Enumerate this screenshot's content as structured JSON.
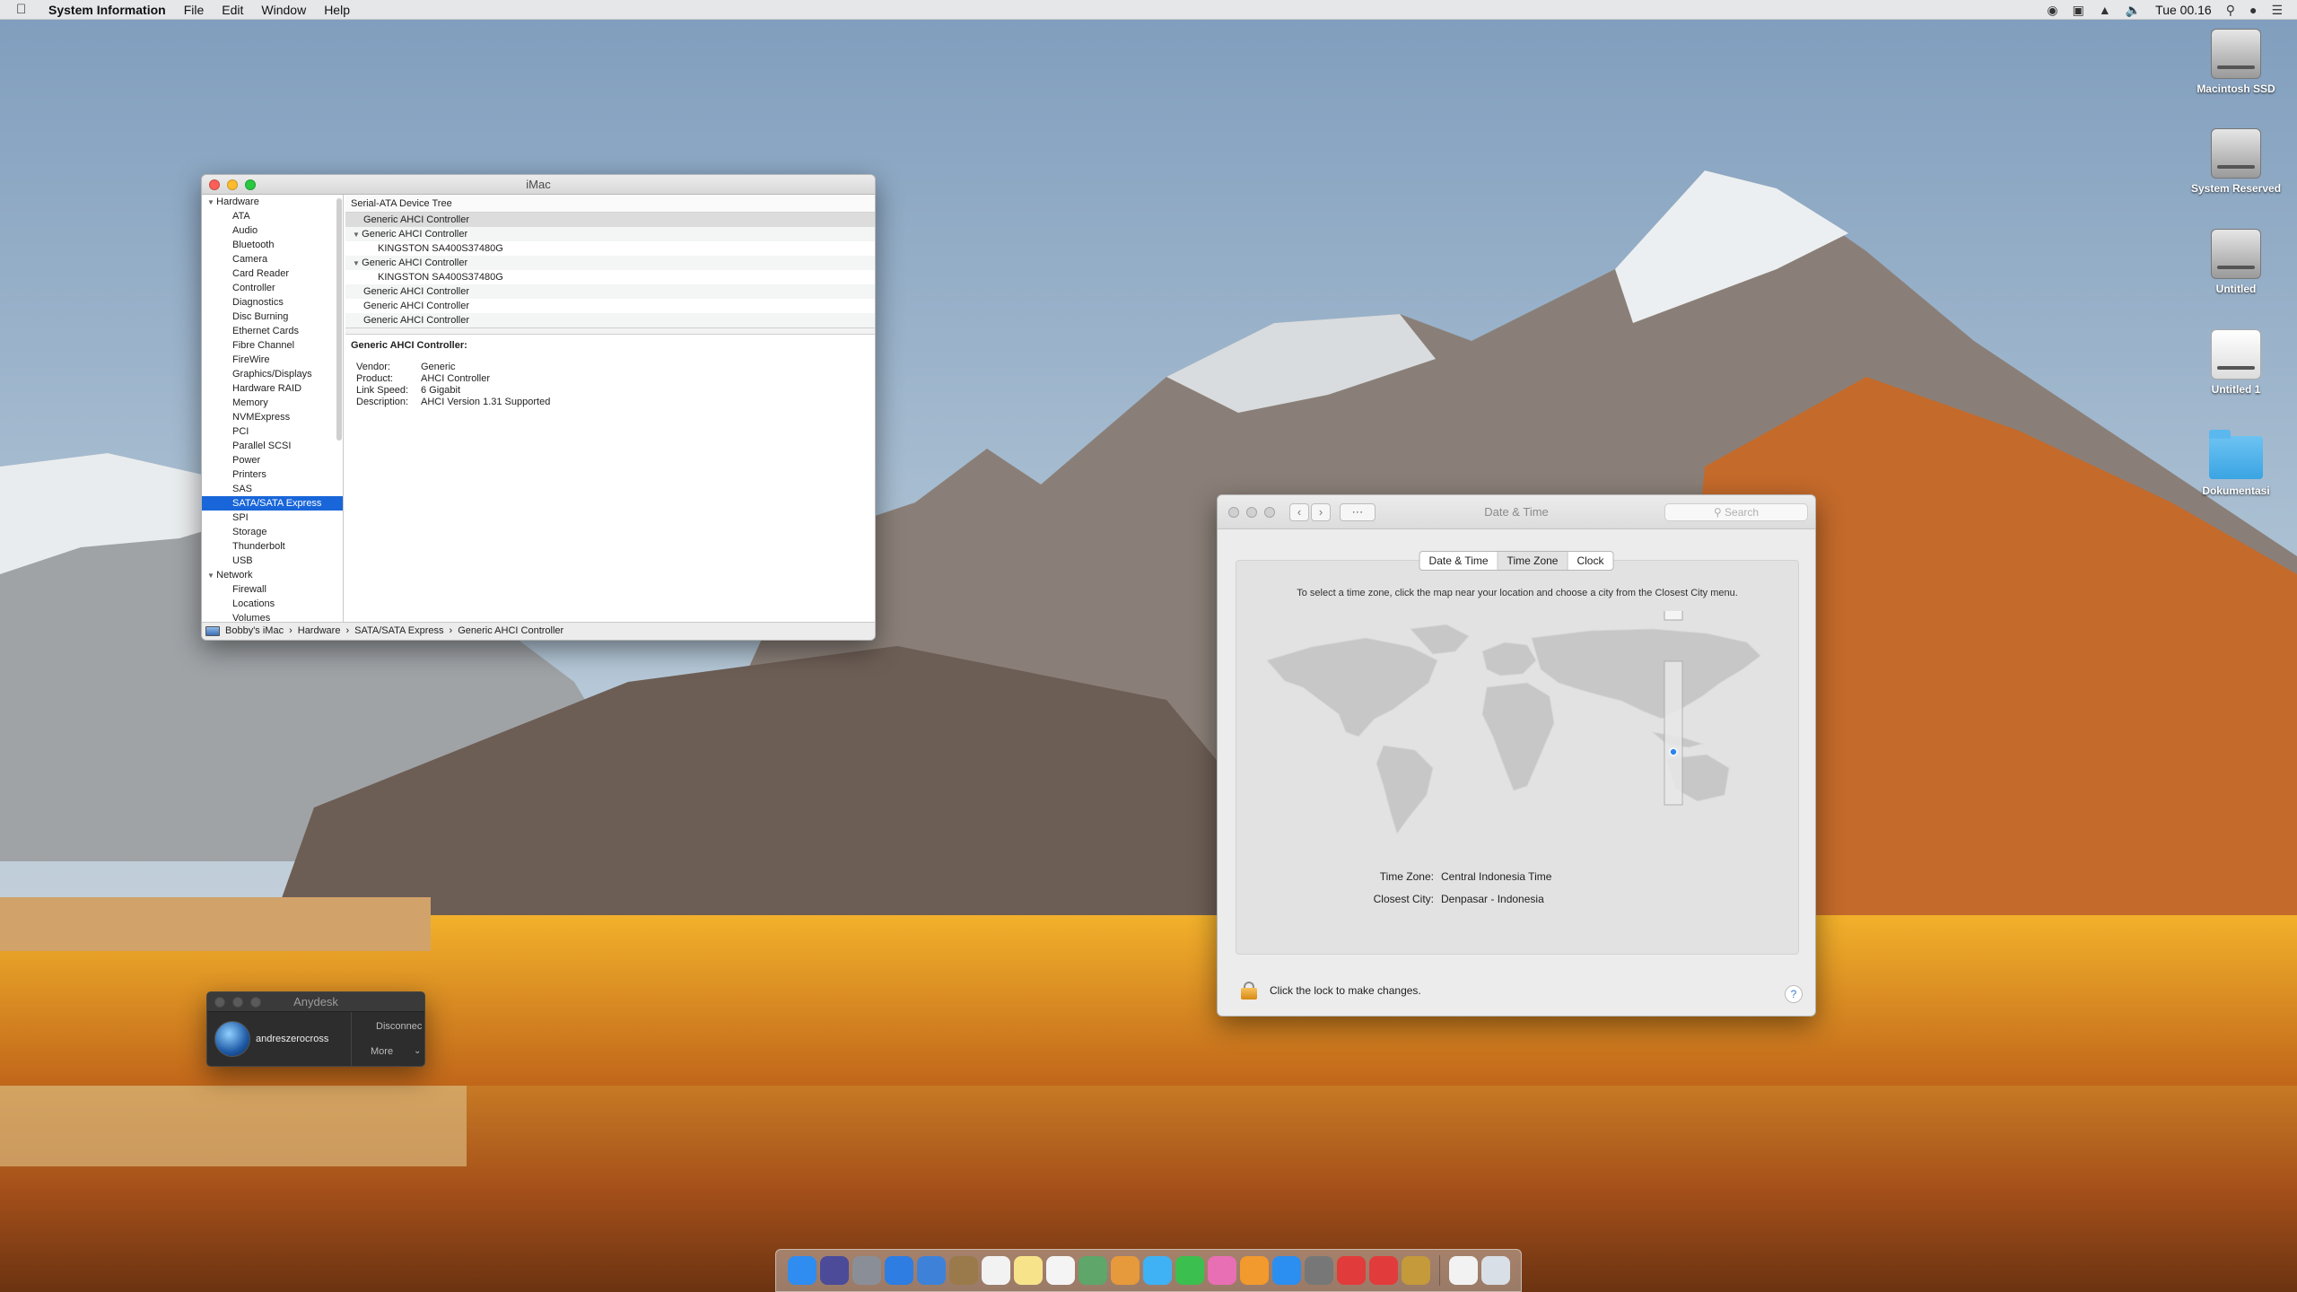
{
  "menubar": {
    "app_name": "System Information",
    "menus": [
      "File",
      "Edit",
      "Window",
      "Help"
    ],
    "clock": "Tue 00.16"
  },
  "desktop_icons": [
    {
      "label": "Macintosh SSD",
      "kind": "disk"
    },
    {
      "label": "System Reserved",
      "kind": "disk"
    },
    {
      "label": "Untitled",
      "kind": "disk"
    },
    {
      "label": "Untitled 1",
      "kind": "white-disk"
    },
    {
      "label": "Dokumentasi",
      "kind": "folder"
    }
  ],
  "sysinfo": {
    "title": "iMac",
    "sidebar": [
      {
        "label": "Hardware",
        "type": "group"
      },
      {
        "label": "ATA",
        "type": "leaf"
      },
      {
        "label": "Audio",
        "type": "leaf"
      },
      {
        "label": "Bluetooth",
        "type": "leaf"
      },
      {
        "label": "Camera",
        "type": "leaf"
      },
      {
        "label": "Card Reader",
        "type": "leaf"
      },
      {
        "label": "Controller",
        "type": "leaf"
      },
      {
        "label": "Diagnostics",
        "type": "leaf"
      },
      {
        "label": "Disc Burning",
        "type": "leaf"
      },
      {
        "label": "Ethernet Cards",
        "type": "leaf"
      },
      {
        "label": "Fibre Channel",
        "type": "leaf"
      },
      {
        "label": "FireWire",
        "type": "leaf"
      },
      {
        "label": "Graphics/Displays",
        "type": "leaf"
      },
      {
        "label": "Hardware RAID",
        "type": "leaf"
      },
      {
        "label": "Memory",
        "type": "leaf"
      },
      {
        "label": "NVMExpress",
        "type": "leaf"
      },
      {
        "label": "PCI",
        "type": "leaf"
      },
      {
        "label": "Parallel SCSI",
        "type": "leaf"
      },
      {
        "label": "Power",
        "type": "leaf"
      },
      {
        "label": "Printers",
        "type": "leaf"
      },
      {
        "label": "SAS",
        "type": "leaf"
      },
      {
        "label": "SATA/SATA Express",
        "type": "leaf",
        "selected": true
      },
      {
        "label": "SPI",
        "type": "leaf"
      },
      {
        "label": "Storage",
        "type": "leaf"
      },
      {
        "label": "Thunderbolt",
        "type": "leaf"
      },
      {
        "label": "USB",
        "type": "leaf"
      },
      {
        "label": "Network",
        "type": "group"
      },
      {
        "label": "Firewall",
        "type": "leaf"
      },
      {
        "label": "Locations",
        "type": "leaf"
      },
      {
        "label": "Volumes",
        "type": "leaf"
      }
    ],
    "tree_header": "Serial-ATA Device Tree",
    "tree_rows": [
      {
        "label": "Generic AHCI Controller",
        "level": 1,
        "selected": true
      },
      {
        "label": "Generic AHCI Controller",
        "level": 1,
        "expanded": true
      },
      {
        "label": "KINGSTON SA400S37480G",
        "level": 2
      },
      {
        "label": "Generic AHCI Controller",
        "level": 1,
        "expanded": true
      },
      {
        "label": "KINGSTON SA400S37480G",
        "level": 2
      },
      {
        "label": "Generic AHCI Controller",
        "level": 1
      },
      {
        "label": "Generic AHCI Controller",
        "level": 1
      },
      {
        "label": "Generic AHCI Controller",
        "level": 1
      }
    ],
    "detail": {
      "title": "Generic AHCI Controller:",
      "fields": [
        {
          "key": "Vendor:",
          "value": "Generic"
        },
        {
          "key": "Product:",
          "value": "AHCI Controller"
        },
        {
          "key": "Link Speed:",
          "value": "6 Gigabit"
        },
        {
          "key": "Description:",
          "value": "AHCI Version 1.31 Supported"
        }
      ]
    },
    "path": [
      "Bobby's iMac",
      "Hardware",
      "SATA/SATA Express",
      "Generic AHCI Controller"
    ]
  },
  "datetime": {
    "title": "Date & Time",
    "search_placeholder": "Search",
    "tabs": [
      {
        "label": "Date & Time",
        "active": false
      },
      {
        "label": "Time Zone",
        "active": true
      },
      {
        "label": "Clock",
        "active": false
      }
    ],
    "hint": "To select a time zone, click the map near your location and choose a city from the Closest City menu.",
    "time_zone_label": "Time Zone:",
    "time_zone_value": "Central Indonesia Time",
    "closest_city_label": "Closest City:",
    "closest_city_value": "Denpasar - Indonesia",
    "lock_text": "Click the lock to make changes.",
    "help": "?"
  },
  "anydesk": {
    "title": "Anydesk",
    "user": "andreszerocross",
    "disconnect": "Disconnec",
    "more": "More"
  },
  "dock": [
    {
      "name": "finder",
      "color": "#2f8cf0"
    },
    {
      "name": "siri",
      "color": "#4b4b9a"
    },
    {
      "name": "launchpad",
      "color": "#8a8f97"
    },
    {
      "name": "safari",
      "color": "#2d7de3"
    },
    {
      "name": "mail",
      "color": "#3d82d8"
    },
    {
      "name": "notes-book",
      "color": "#9a7a4b"
    },
    {
      "name": "calendar",
      "color": "#f2f2f2"
    },
    {
      "name": "notes",
      "color": "#f7e38a"
    },
    {
      "name": "reminders",
      "color": "#f4f4f4"
    },
    {
      "name": "maps",
      "color": "#5ea66a"
    },
    {
      "name": "photos",
      "color": "#e79a3b"
    },
    {
      "name": "messages",
      "color": "#3fb2f5"
    },
    {
      "name": "facetime",
      "color": "#3bbf4f"
    },
    {
      "name": "itunes",
      "color": "#e86fb4"
    },
    {
      "name": "ibooks",
      "color": "#f29a2e"
    },
    {
      "name": "app-store",
      "color": "#2b8ef1"
    },
    {
      "name": "system-preferences",
      "color": "#777777"
    },
    {
      "name": "anydesk",
      "color": "#e23b3b"
    },
    {
      "name": "anydesk-2",
      "color": "#e23b3b"
    },
    {
      "name": "system-information",
      "color": "#c49a3a"
    },
    {
      "name": "documents",
      "color": "#f2f2f2"
    },
    {
      "name": "trash",
      "color": "#d9dfe6"
    }
  ]
}
